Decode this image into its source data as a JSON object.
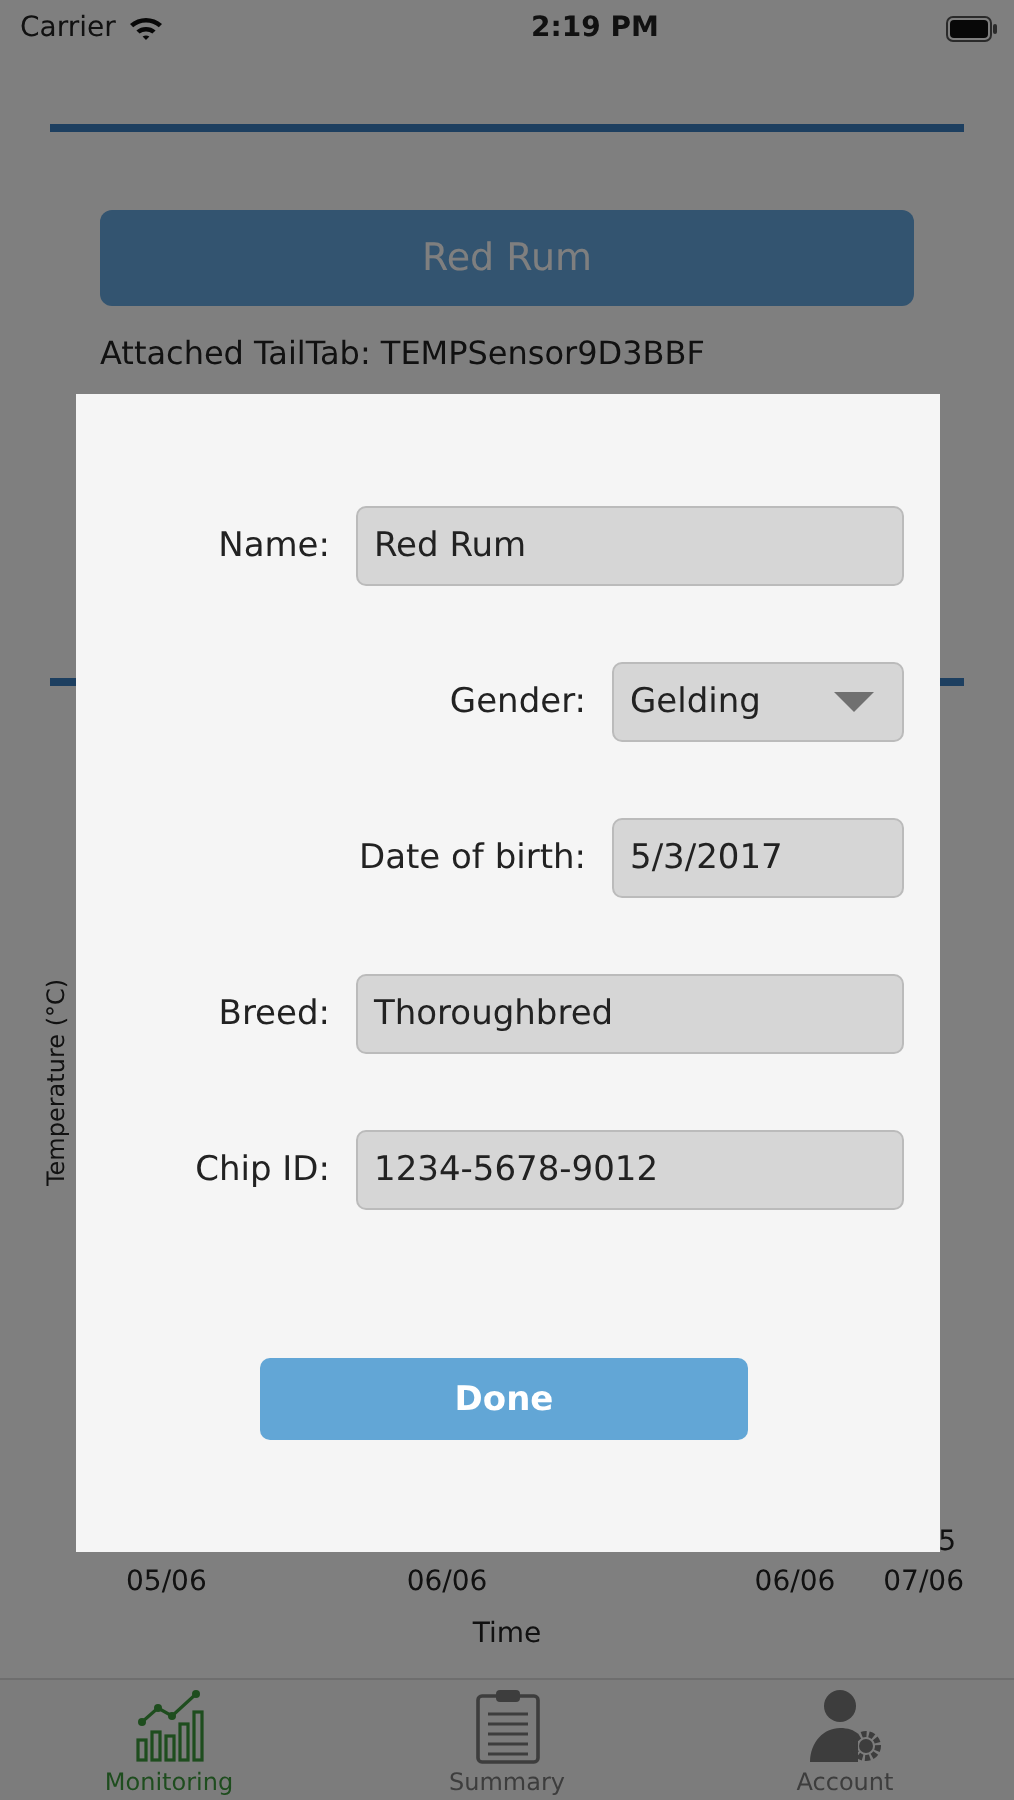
{
  "status_bar": {
    "carrier": "Carrier",
    "time": "2:19 PM"
  },
  "horse_card": {
    "name_button": "Red Rum",
    "tailtab_text": "Attached TailTab: TEMPSensor9D3BBF"
  },
  "chart": {
    "ylabel": "Temperature (°C)",
    "ytick_fragment": "5",
    "xticks": [
      "05/06",
      "06/06",
      "06/06",
      "07/06"
    ],
    "xlabel": "Time"
  },
  "dialog": {
    "fields": [
      {
        "label": "Name:",
        "value": "Red Rum",
        "kind": "text"
      },
      {
        "label": "Gender:",
        "value": "Gelding",
        "kind": "dropdown"
      },
      {
        "label": "Date of birth:",
        "value": "5/3/2017",
        "kind": "date"
      },
      {
        "label": "Breed:",
        "value": "Thoroughbred",
        "kind": "text"
      },
      {
        "label": "Chip ID:",
        "value": "1234-5678-9012",
        "kind": "text"
      }
    ],
    "done_button": "Done"
  },
  "tab_bar": [
    {
      "label": "Monitoring",
      "selected": true
    },
    {
      "label": "Summary",
      "selected": false
    },
    {
      "label": "Account",
      "selected": false
    }
  ]
}
